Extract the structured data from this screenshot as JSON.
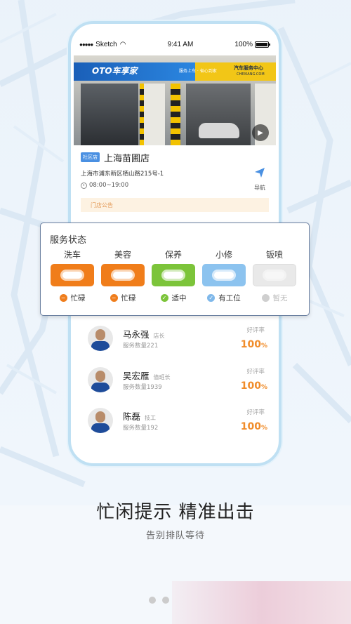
{
  "status_bar": {
    "carrier": "Sketch",
    "time": "9:41 AM",
    "battery": "100%"
  },
  "store": {
    "sign_logo": "OTO车享家",
    "sign_slogan": "服务上车 · 省心到家",
    "sign_right": "汽车服务中心",
    "sign_right_sub": "CHEXIANG.COM",
    "tag": "社区店",
    "name": "上海苗圃店",
    "address": "上海市浦东新区栖山路215号-1",
    "hours": "08:00~19:00",
    "nav_label": "导航",
    "notice": "门店公告"
  },
  "service_status": {
    "title": "服务状态",
    "items": [
      {
        "name": "洗车",
        "status": "忙碌",
        "color": "#f07d1a",
        "dot_color": "#ef7d1c",
        "dot_glyph": "−"
      },
      {
        "name": "美容",
        "status": "忙碌",
        "color": "#f07d1a",
        "dot_color": "#ef7d1c",
        "dot_glyph": "−"
      },
      {
        "name": "保养",
        "status": "适中",
        "color": "#7cc43a",
        "dot_color": "#7cc43a",
        "dot_glyph": "✓"
      },
      {
        "name": "小修",
        "status": "有工位",
        "color": "#8cc3ef",
        "dot_color": "#7fb8ea",
        "dot_glyph": "✓"
      },
      {
        "name": "钣喷",
        "status": "暂无",
        "color": "#e0e0e0",
        "dot_color": "#cfcfcf",
        "dot_glyph": ""
      }
    ]
  },
  "staff": [
    {
      "name": "马永强",
      "role": "店长",
      "count_label": "服务数量221",
      "rating_label": "好评率",
      "rating": "100",
      "rating_unit": "%"
    },
    {
      "name": "吴宏雁",
      "role": "值班长",
      "count_label": "服务数量1939",
      "rating_label": "好评率",
      "rating": "100",
      "rating_unit": "%"
    },
    {
      "name": "陈磊",
      "role": "技工",
      "count_label": "服务数量192",
      "rating_label": "好评率",
      "rating": "100",
      "rating_unit": "%"
    }
  ],
  "caption": {
    "headline": "忙闲提示 精准出击",
    "subline": "告别排队等待"
  }
}
